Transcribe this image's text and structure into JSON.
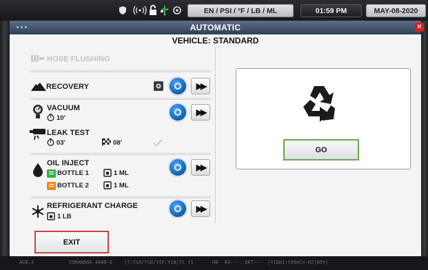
{
  "status_bar": {
    "units": "EN / PSI / °F / LB / ML",
    "time": "01:59 PM",
    "date": "MAY-08-2020",
    "icons": [
      "shield-icon",
      "wifi-signal-icon",
      "lock-icon",
      "usb-icon",
      "sync-icon"
    ]
  },
  "window": {
    "title": "AUTOMATIC",
    "close_symbol": "×"
  },
  "vehicle": "VEHICLE: STANDARD",
  "procedures": {
    "hose_flushing": {
      "label": "HOSE FLUSHING",
      "enabled": false
    },
    "recovery": {
      "label": "RECOVERY"
    },
    "vacuum": {
      "label": "VACUUM",
      "time": "10'"
    },
    "leak_test": {
      "label": "LEAK TEST",
      "time": "03'",
      "check_time": "08'"
    },
    "oil_inject": {
      "label": "OIL INJECT",
      "bottles": [
        {
          "label": "BOTTLE 1",
          "amount": "1 ML",
          "color": "#2eb34a"
        },
        {
          "label": "BOTTLE 2",
          "amount": "1 ML",
          "color": "#f0881a"
        }
      ]
    },
    "refrigerant_charge": {
      "label": "REFRIGERANT CHARGE",
      "amount": "1 LB"
    }
  },
  "go_label": "GO",
  "exit_label": "EXIT",
  "footer": {
    "items": [
      "ACB.4",
      "COMANDOS 4000-S",
      "|T:Y10/Y10/Y1P:Y1N|T1 Y1",
      "HR",
      "KV---.-DET---",
      "|Y1Sm1:Y20eCo-N2|NOY|"
    ]
  },
  "colors": {
    "accent_blue": "#0a5ea8",
    "go_border": "#6aa84f",
    "exit_border": "#d04040",
    "titlebar": "#3f5068"
  }
}
